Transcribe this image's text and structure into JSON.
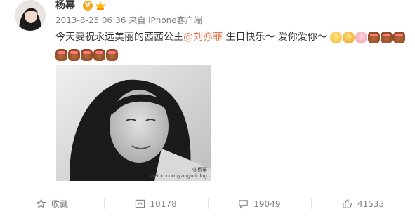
{
  "user": {
    "name": "杨幂",
    "verified_badge": "V",
    "vip_icon": "vip-crown-icon"
  },
  "post": {
    "time": "2013-8-25 06:36",
    "source": "来自 iPhone客户端",
    "text_before": "今天要祝永远美丽的茜茜公主",
    "mention": "@刘亦菲",
    "text_after": " 生日快乐～ 爱你爱你～",
    "emojis_line1": [
      "smile",
      "grin",
      "pig",
      "cake",
      "cake",
      "cake"
    ],
    "emojis_line2": [
      "cake",
      "cake",
      "cake",
      "cake",
      "cake"
    ],
    "watermark_line1": "@杨幂",
    "watermark_line2": "weibo.com/yangmiblog"
  },
  "actions": {
    "favorite_label": "收藏",
    "repost_count": "10178",
    "comment_count": "19049",
    "like_count": "41533"
  },
  "colors": {
    "mention": "#eb7350",
    "meta": "#808080",
    "badge": "#f5a623"
  }
}
